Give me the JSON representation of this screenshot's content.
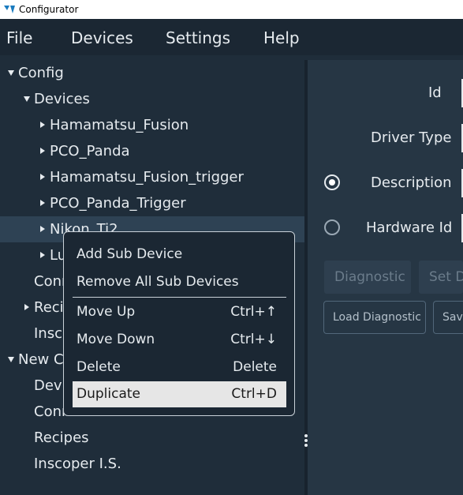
{
  "window": {
    "title": "Configurator",
    "logo_icon": "configurator-logo-icon"
  },
  "menubar": {
    "items": [
      "File",
      "Devices",
      "Settings",
      "Help"
    ]
  },
  "tree": {
    "config": "Config",
    "devices": "Devices",
    "device_items": [
      "Hamamatsu_Fusion",
      "PCO_Panda",
      "Hamamatsu_Fusion_trigger",
      "PCO_Panda_Trigger",
      "Nikon_Ti2",
      "Lu"
    ],
    "conn": "Conn",
    "recip": "Recip",
    "insco": "Insco",
    "new_config": "New Co",
    "new_config_items": [
      "Devi",
      "Conn",
      "Recipes",
      "Inscoper I.S."
    ]
  },
  "right_panel": {
    "id_label": "Id",
    "driver_type_label": "Driver Type",
    "description_label": "Description",
    "hardware_id_label": "Hardware Id",
    "diagnostic_button": "Diagnostic",
    "set_button": "Set D",
    "load_diagnostic_button": "Load Diagnostic",
    "save_button": "Save"
  },
  "context_menu": {
    "add_sub_device": "Add Sub Device",
    "remove_all_sub_devices": "Remove All Sub Devices",
    "move_up": "Move Up",
    "move_up_shortcut": "Ctrl+↑",
    "move_down": "Move Down",
    "move_down_shortcut": "Ctrl+↓",
    "delete": "Delete",
    "delete_shortcut": "Delete",
    "duplicate": "Duplicate",
    "duplicate_shortcut": "Ctrl+D"
  },
  "colors": {
    "background": "#1f2d3a",
    "right_panel": "#263644",
    "highlight": "#e6e6e6"
  }
}
